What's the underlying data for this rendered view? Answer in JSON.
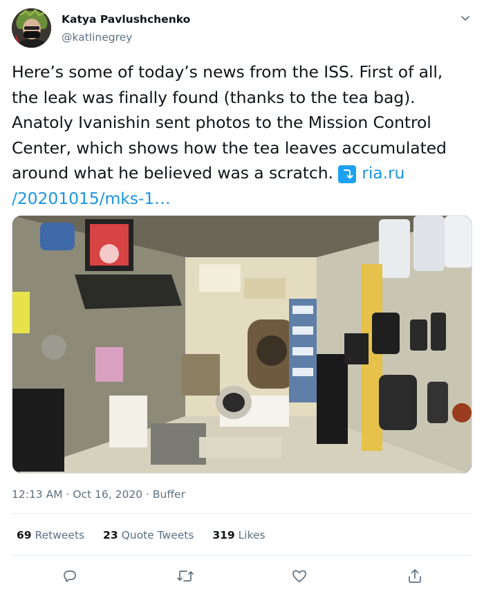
{
  "user": {
    "display_name": "Katya Pavlushchenko",
    "handle": "@katlinegrey"
  },
  "tweet": {
    "lines": [
      "Here’s some of today’s news from the ISS. First of all,",
      "the leak was finally found (thanks to the tea bag).",
      "Anatoly Ivanishin sent photos to the Mission Control",
      "Center, which shows how the tea leaves accumulated"
    ],
    "line5_text": "around what he believed was a scratch.",
    "emoji": "↴",
    "link_part1": "ria.ru",
    "link_part2": "/20201015/mks-1…"
  },
  "meta": {
    "time": "12:13 AM",
    "sep1": " · ",
    "date": "Oct 16, 2020",
    "sep2": " · ",
    "source": "Buffer"
  },
  "stats": {
    "retweets_count": "69",
    "retweets_label": "Retweets",
    "quotes_count": "23",
    "quotes_label": "Quote Tweets",
    "likes_count": "319",
    "likes_label": "Likes"
  },
  "icons": {
    "reply": "reply-icon",
    "retweet": "retweet-icon",
    "like": "heart-icon",
    "share": "share-icon",
    "more": "chevron-down-icon"
  },
  "colors": {
    "link": "#1b95e0",
    "secondary_text": "#5b7083",
    "emoji_bg": "#1da1f2"
  }
}
